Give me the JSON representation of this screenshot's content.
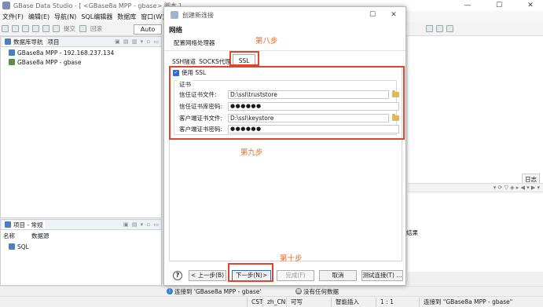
{
  "window": {
    "title": "GBase Data Studio - [ <GBase8a MPP - gbase> 脚本 ]",
    "min": "—",
    "max": "☐",
    "close": "✕"
  },
  "menu": [
    "文件(F)",
    "编辑(E)",
    "导航(N)",
    "SQL编辑器",
    "数据库",
    "窗口(W)"
  ],
  "toolbar": {
    "submit": "提交",
    "rollback": "回滚",
    "auto": "Auto"
  },
  "navigator": {
    "tab1": "数据库导航",
    "tab2": "项目",
    "items": [
      "GBase8a MPP - 192.168.237.134",
      "GBase8a MPP - gbase"
    ]
  },
  "project_pane": {
    "title": "项目 - 常规",
    "col_name": "名称",
    "col_source": "数据源",
    "items": [
      "SQL"
    ]
  },
  "right_panel": {
    "log_tab": "日志",
    "result_fragment": "结果"
  },
  "dialog": {
    "title": "创建新连接",
    "header_title": "网络",
    "header_subtitle": "配置网络处理器",
    "tabs": [
      "SSH隧道",
      "SOCKS代理",
      "SSL"
    ],
    "use_ssl_label": "使用 SSL",
    "cert_group_label": "证书",
    "fields": [
      {
        "label": "信任证书文件:",
        "value": "D:\\ssl\\truststore"
      },
      {
        "label": "信任证书库密码:",
        "value": "●●●●●●"
      },
      {
        "label": "客户端证书文件:",
        "value": "D:\\ssl\\keystore"
      },
      {
        "label": "客户端证书密码:",
        "value": "●●●●●●"
      }
    ],
    "buttons": {
      "help": "?",
      "back": "< 上一步(B)",
      "next": "下一步(N)>",
      "finish": "完成(F)",
      "cancel": "取消",
      "test": "测试连接(T) ..."
    }
  },
  "annotations": {
    "step8": "第八步",
    "step9": "第九步",
    "step10": "第十步",
    "color": "#e0452a"
  },
  "status": {
    "connected": "连接到 'GBase8a MPP - gbase'",
    "no_data": "没有任何数据",
    "tz": "CST",
    "locale": "zh_CN",
    "mode": "可写",
    "insert": "智能插入",
    "pos": "1 : 1",
    "right_msg": "连接到 \"GBase8a MPP - gbase\""
  }
}
